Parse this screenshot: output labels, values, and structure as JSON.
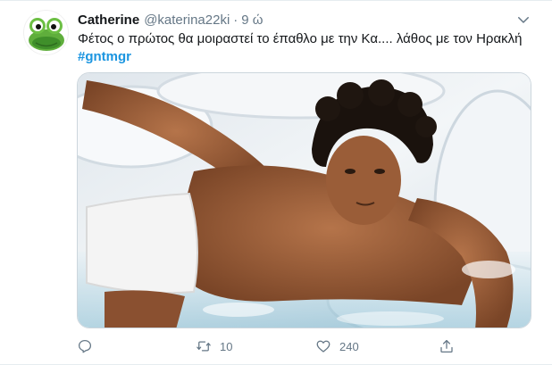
{
  "tweet": {
    "author_name": "Catherine",
    "author_handle": "@katerina22ki",
    "separator": "·",
    "time": "9 ώ",
    "text": "Φέτος ο πρώτος θα μοιραστεί το έπαθλο με την Κα.... λάθος με τον Ηρακλή",
    "hashtag": "#gntmgr",
    "avatar_icon": "frog-avatar-icon",
    "media_description_icon": "photo-icon",
    "link_color": "#1b95e0",
    "muted_color": "#657786"
  },
  "actions": {
    "reply_icon": "reply-icon",
    "reply_count": "",
    "retweet_icon": "retweet-icon",
    "retweet_count": "10",
    "like_icon": "heart-icon",
    "like_count": "240",
    "share_icon": "share-icon"
  },
  "menu_icon": "chevron-down-icon"
}
